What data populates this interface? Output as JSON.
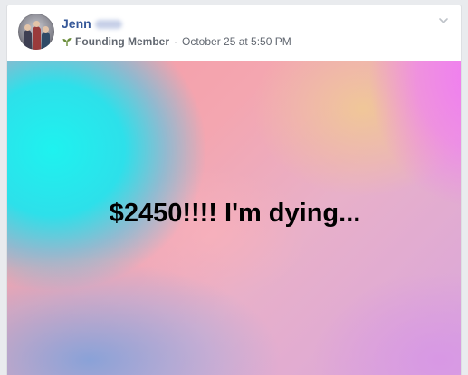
{
  "post": {
    "author_name": "Jenn",
    "badge_icon": "sprout-icon",
    "badge_label": "Founding Member",
    "separator": "·",
    "timestamp": "October 25 at 5:50 PM",
    "text": "$2450!!!! I'm dying...",
    "options_icon": "chevron-down-icon"
  },
  "colors": {
    "author_link": "#365899",
    "meta_text": "#606770",
    "post_text": "#000000",
    "badge_icon": "#6a8d3a"
  }
}
